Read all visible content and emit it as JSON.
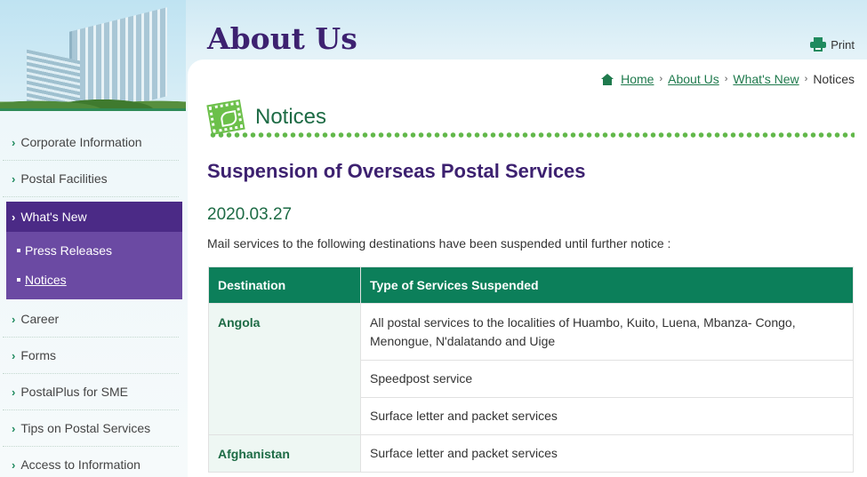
{
  "header": {
    "title": "About Us",
    "print_label": "Print"
  },
  "breadcrumb": {
    "items": [
      "Home",
      "About Us",
      "What's New"
    ],
    "current": "Notices",
    "separator": "›"
  },
  "sidebar": {
    "items_top": [
      "Corporate Information",
      "Postal Facilities"
    ],
    "active": "What's New",
    "sub_items": [
      "Press Releases",
      "Notices"
    ],
    "items_bottom": [
      "Career",
      "Forms",
      "PostalPlus for SME",
      "Tips on Postal Services",
      "Access to Information"
    ],
    "chevron": "›"
  },
  "section": {
    "title": "Notices"
  },
  "article": {
    "title": "Suspension of Overseas Postal Services",
    "date": "2020.03.27",
    "intro": "Mail services to the following destinations have been suspended until further notice :"
  },
  "table": {
    "headers": [
      "Destination",
      "Type of Services Suspended"
    ],
    "rows": [
      {
        "destination": "Angola",
        "services": [
          "All postal services to the localities of Huambo, Kuito, Luena, Mbanza- Congo, Menongue, N'dalatando and Uige",
          "Speedpost service",
          "Surface letter and packet services"
        ]
      },
      {
        "destination": "Afghanistan",
        "services": [
          "Surface letter and packet services"
        ]
      }
    ]
  },
  "colors": {
    "brand_purple": "#3d2170",
    "brand_green": "#0c7f5a",
    "sidebar_active": "#4b2a86",
    "dots_green": "#62b84a"
  }
}
